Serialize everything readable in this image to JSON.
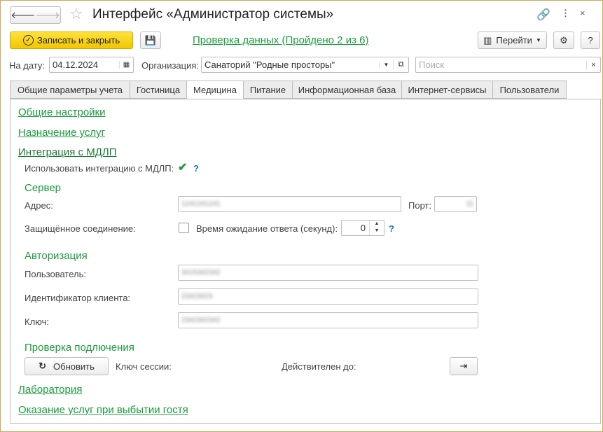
{
  "window": {
    "title": "Интерфейс «Администратор системы»"
  },
  "toolbar": {
    "save_close": "Записать и закрыть",
    "check_link": "Проверка данных (Пройдено 2 из 6)",
    "goto": "Перейти",
    "help": "?"
  },
  "filters": {
    "date_label": "На дату:",
    "date_value": "04.12.2024",
    "org_label": "Организация:",
    "org_value": "Санаторий \"Родные просторы\"",
    "search_placeholder": "Поиск"
  },
  "tabs": [
    {
      "label": "Общие параметры учета"
    },
    {
      "label": "Гостиница"
    },
    {
      "label": "Медицина"
    },
    {
      "label": "Питание"
    },
    {
      "label": "Информационная база"
    },
    {
      "label": "Интернет-сервисы"
    },
    {
      "label": "Пользователи"
    }
  ],
  "content": {
    "general_settings": "Общие настройки",
    "services": "Назначение услуг",
    "mdlp": "Интеграция с МДЛП",
    "use_mdlp_label": "Использовать интеграцию с МДЛП:",
    "help": "?",
    "server_title": "Сервер",
    "address_label": "Адрес:",
    "address_value": "1241241241",
    "port_label": "Порт:",
    "port_value": "11",
    "secure_label": "Защищённое соединение:",
    "timeout_label": "Время ожидание ответа (секунд):",
    "timeout_value": "0",
    "auth_title": "Авторизация",
    "user_label": "Пользователь:",
    "user_value": "3415342342",
    "client_label": "Идентификатор клиента:",
    "client_value": "23423423",
    "key_label": "Ключ:",
    "key_value": "2342342342",
    "conn_title": "Проверка подлючения",
    "refresh": "Обновить",
    "session_label": "Ключ сессии:",
    "valid_label": "Действителен до:",
    "lab": "Лаборатория",
    "checkout": "Оказание услуг при выбытии гостя"
  }
}
